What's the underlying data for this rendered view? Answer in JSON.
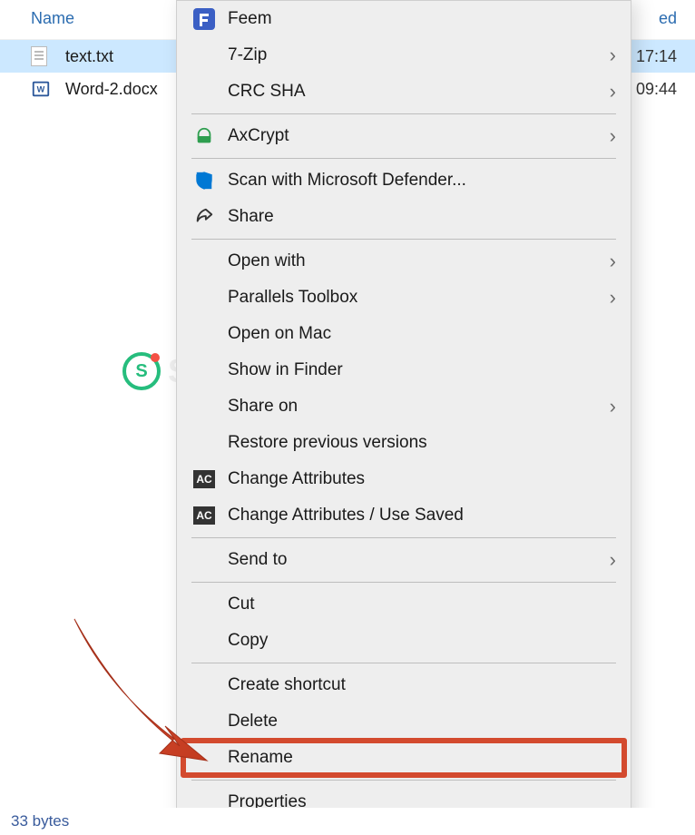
{
  "columns": {
    "name": "Name",
    "modified_suffix": "ed"
  },
  "files": [
    {
      "name": "text.txt",
      "time": "17:14",
      "selected": true,
      "icon": "txt"
    },
    {
      "name": "Word-2.docx",
      "time": "09:44",
      "selected": false,
      "icon": "docx"
    }
  ],
  "watermark": {
    "badge": "S",
    "text": "SINFO"
  },
  "context_menu": {
    "groups": [
      [
        {
          "label": "Feem",
          "icon": "feem",
          "submenu": false
        },
        {
          "label": "7-Zip",
          "icon": "",
          "submenu": true
        },
        {
          "label": "CRC SHA",
          "icon": "",
          "submenu": true
        }
      ],
      [
        {
          "label": "AxCrypt",
          "icon": "axcrypt",
          "submenu": true
        }
      ],
      [
        {
          "label": "Scan with Microsoft Defender...",
          "icon": "shield",
          "submenu": false
        },
        {
          "label": "Share",
          "icon": "share",
          "submenu": false
        }
      ],
      [
        {
          "label": "Open with",
          "icon": "",
          "submenu": true
        },
        {
          "label": "Parallels Toolbox",
          "icon": "",
          "submenu": true
        },
        {
          "label": "Open on Mac",
          "icon": "",
          "submenu": false
        },
        {
          "label": "Show in Finder",
          "icon": "",
          "submenu": false
        },
        {
          "label": "Share on",
          "icon": "",
          "submenu": true
        },
        {
          "label": "Restore previous versions",
          "icon": "",
          "submenu": false
        },
        {
          "label": "Change Attributes",
          "icon": "ac",
          "submenu": false
        },
        {
          "label": "Change Attributes / Use Saved",
          "icon": "ac",
          "submenu": false
        }
      ],
      [
        {
          "label": "Send to",
          "icon": "",
          "submenu": true
        }
      ],
      [
        {
          "label": "Cut",
          "icon": "",
          "submenu": false
        },
        {
          "label": "Copy",
          "icon": "",
          "submenu": false
        }
      ],
      [
        {
          "label": "Create shortcut",
          "icon": "",
          "submenu": false
        },
        {
          "label": "Delete",
          "icon": "",
          "submenu": false
        },
        {
          "label": "Rename",
          "icon": "",
          "submenu": false,
          "highlighted": true
        }
      ],
      [
        {
          "label": "Properties",
          "icon": "",
          "submenu": false
        }
      ]
    ]
  },
  "status": {
    "size": "33 bytes"
  },
  "icons": {
    "ac_label": "AC"
  },
  "annotation": {
    "arrow": true,
    "highlight_target": "Rename"
  }
}
